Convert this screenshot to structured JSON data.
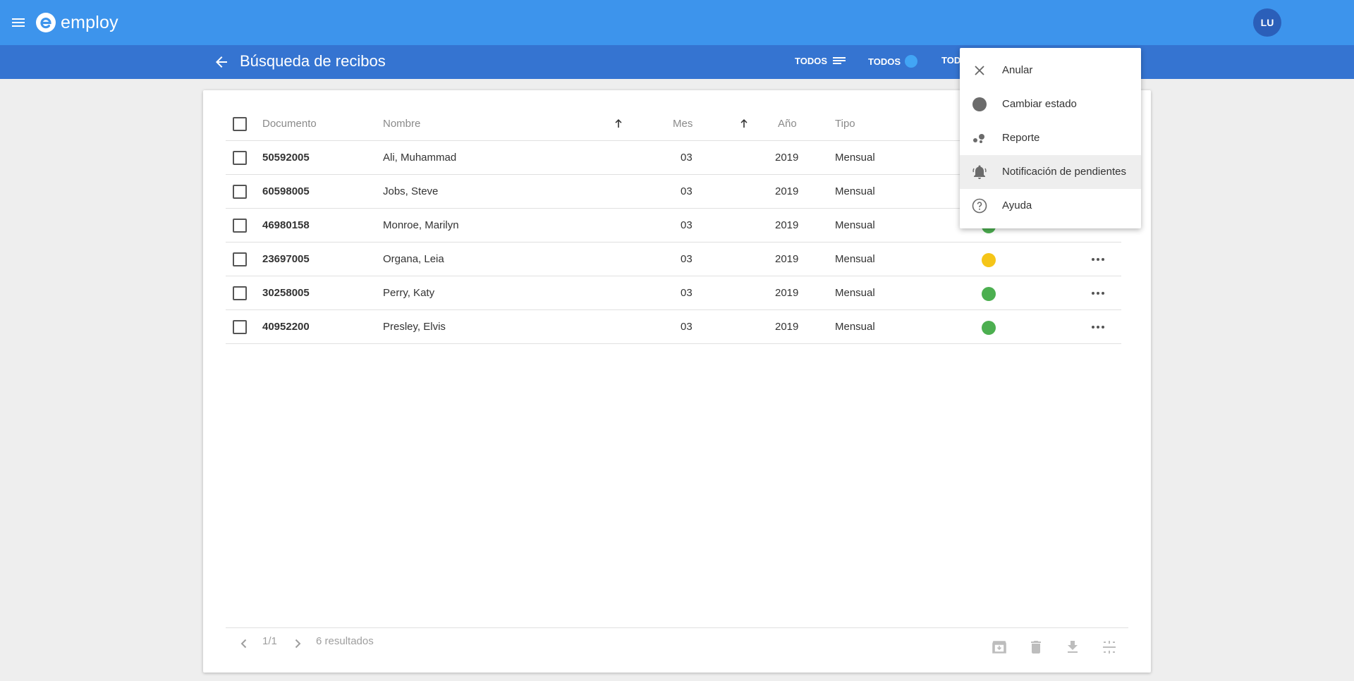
{
  "app": {
    "name": "employ",
    "user_initials": "LU"
  },
  "header": {
    "title": "Búsqueda de recibos",
    "filters": [
      "TODOS",
      "TODOS",
      "TOD"
    ]
  },
  "table": {
    "columns": [
      "Documento",
      "Nombre",
      "Mes",
      "Año",
      "Tipo"
    ],
    "rows": [
      {
        "documento": "50592005",
        "nombre": "Ali, Muhammad",
        "mes": "03",
        "anio": "2019",
        "tipo": "Mensual",
        "status": ""
      },
      {
        "documento": "60598005",
        "nombre": "Jobs, Steve",
        "mes": "03",
        "anio": "2019",
        "tipo": "Mensual",
        "status": ""
      },
      {
        "documento": "46980158",
        "nombre": "Monroe, Marilyn",
        "mes": "03",
        "anio": "2019",
        "tipo": "Mensual",
        "status": "green"
      },
      {
        "documento": "23697005",
        "nombre": "Organa, Leia",
        "mes": "03",
        "anio": "2019",
        "tipo": "Mensual",
        "status": "yellow"
      },
      {
        "documento": "30258005",
        "nombre": "Perry, Katy",
        "mes": "03",
        "anio": "2019",
        "tipo": "Mensual",
        "status": "green"
      },
      {
        "documento": "40952200",
        "nombre": "Presley, Elvis",
        "mes": "03",
        "anio": "2019",
        "tipo": "Mensual",
        "status": "green"
      }
    ]
  },
  "footer": {
    "page": "1/1",
    "results": "6 resultados"
  },
  "context_menu": {
    "items": [
      {
        "label": "Anular",
        "icon": "close-icon"
      },
      {
        "label": "Cambiar estado",
        "icon": "circle-icon"
      },
      {
        "label": "Reporte",
        "icon": "bubbles-icon"
      },
      {
        "label": "Notificación de pendientes",
        "icon": "bell-ringing-icon"
      },
      {
        "label": "Ayuda",
        "icon": "help-circle-icon"
      }
    ]
  },
  "colors": {
    "topbar": "#3d94ec",
    "subbar": "#3574d1",
    "status_green": "#4caf50",
    "status_yellow": "#f5c518",
    "filter_dot": "#42a5f5"
  }
}
